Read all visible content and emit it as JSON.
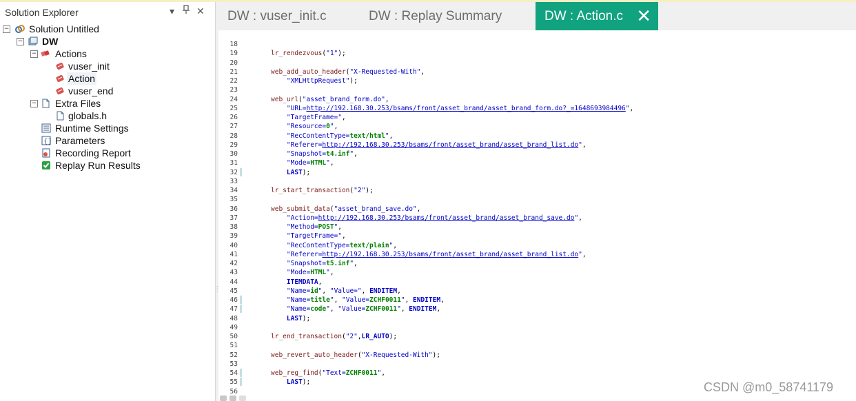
{
  "solution_explorer": {
    "title": "Solution Explorer",
    "controls": {
      "dropdown": "▾",
      "pin": "ꟷ",
      "close": "✕"
    },
    "tree": {
      "solution": "Solution Untitled",
      "project": "DW",
      "actions_folder": "Actions",
      "actions": [
        "vuser_init",
        "Action",
        "vuser_end"
      ],
      "extra_files_folder": "Extra Files",
      "extra_files": [
        "globals.h"
      ],
      "items": [
        "Runtime Settings",
        "Parameters",
        "Recording Report",
        "Replay Run Results"
      ]
    },
    "selected_item": "Action"
  },
  "tabs": [
    {
      "label": "DW : vuser_init.c",
      "active": false
    },
    {
      "label": "DW : Replay Summary",
      "active": false
    },
    {
      "label": "DW : Action.c",
      "active": true
    }
  ],
  "colors": {
    "active_tab": "#11a37f"
  },
  "code": {
    "lines": [
      {
        "n": "18",
        "parts": []
      },
      {
        "n": "19",
        "parts": [
          [
            "fn",
            "lr_rendezvous"
          ],
          [
            "t",
            "("
          ],
          [
            "str",
            "\"1\""
          ],
          [
            "t",
            ");"
          ]
        ]
      },
      {
        "n": "20",
        "parts": []
      },
      {
        "n": "21",
        "parts": [
          [
            "fn",
            "web_add_auto_header"
          ],
          [
            "t",
            "("
          ],
          [
            "str",
            "\"X-Requested-With\""
          ],
          [
            "t",
            ","
          ]
        ]
      },
      {
        "n": "22",
        "parts": [
          [
            "t",
            "    "
          ],
          [
            "str",
            "\"XMLHttpRequest\""
          ],
          [
            "t",
            ");"
          ]
        ]
      },
      {
        "n": "23",
        "parts": []
      },
      {
        "n": "24",
        "parts": [
          [
            "fn",
            "web_url"
          ],
          [
            "t",
            "("
          ],
          [
            "str",
            "\"asset_brand_form.do\""
          ],
          [
            "t",
            ","
          ]
        ]
      },
      {
        "n": "25",
        "parts": [
          [
            "t",
            "    "
          ],
          [
            "str",
            "\"URL="
          ],
          [
            "url",
            "http://192.168.30.253/bsams/front/asset_brand/asset_brand_form.do?_=1648693984496"
          ],
          [
            "str",
            "\""
          ],
          [
            "t",
            ","
          ]
        ]
      },
      {
        "n": "26",
        "parts": [
          [
            "t",
            "    "
          ],
          [
            "str",
            "\"TargetFrame=\""
          ],
          [
            "t",
            ","
          ]
        ]
      },
      {
        "n": "27",
        "parts": [
          [
            "t",
            "    "
          ],
          [
            "str",
            "\"Resource="
          ],
          [
            "gr",
            "0"
          ],
          [
            "str",
            "\""
          ],
          [
            "t",
            ","
          ]
        ]
      },
      {
        "n": "28",
        "parts": [
          [
            "t",
            "    "
          ],
          [
            "str",
            "\"RecContentType="
          ],
          [
            "gr",
            "text/html"
          ],
          [
            "str",
            "\""
          ],
          [
            "t",
            ","
          ]
        ]
      },
      {
        "n": "29",
        "parts": [
          [
            "t",
            "    "
          ],
          [
            "str",
            "\"Referer="
          ],
          [
            "url",
            "http://192.168.30.253/bsams/front/asset_brand/asset_brand_list.do"
          ],
          [
            "str",
            "\""
          ],
          [
            "t",
            ","
          ]
        ]
      },
      {
        "n": "30",
        "parts": [
          [
            "t",
            "    "
          ],
          [
            "str",
            "\"Snapshot="
          ],
          [
            "gr",
            "t4.inf"
          ],
          [
            "str",
            "\""
          ],
          [
            "t",
            ","
          ]
        ]
      },
      {
        "n": "31",
        "parts": [
          [
            "t",
            "    "
          ],
          [
            "str",
            "\"Mode="
          ],
          [
            "gr",
            "HTML"
          ],
          [
            "str",
            "\""
          ],
          [
            "t",
            ","
          ]
        ]
      },
      {
        "n": "32",
        "parts": [
          [
            "t",
            "    "
          ],
          [
            "kw",
            "LAST"
          ],
          [
            "t",
            ");"
          ]
        ],
        "mark": true
      },
      {
        "n": "33",
        "parts": []
      },
      {
        "n": "34",
        "parts": [
          [
            "fn",
            "lr_start_transaction"
          ],
          [
            "t",
            "("
          ],
          [
            "str",
            "\"2\""
          ],
          [
            "t",
            ");"
          ]
        ]
      },
      {
        "n": "35",
        "parts": []
      },
      {
        "n": "36",
        "parts": [
          [
            "fn",
            "web_submit_data"
          ],
          [
            "t",
            "("
          ],
          [
            "str",
            "\"asset_brand_save.do\""
          ],
          [
            "t",
            ","
          ]
        ]
      },
      {
        "n": "37",
        "parts": [
          [
            "t",
            "    "
          ],
          [
            "str",
            "\"Action="
          ],
          [
            "url",
            "http://192.168.30.253/bsams/front/asset_brand/asset_brand_save.do"
          ],
          [
            "str",
            "\""
          ],
          [
            "t",
            ","
          ]
        ]
      },
      {
        "n": "38",
        "parts": [
          [
            "t",
            "    "
          ],
          [
            "str",
            "\"Method="
          ],
          [
            "gr",
            "POST"
          ],
          [
            "str",
            "\""
          ],
          [
            "t",
            ","
          ]
        ]
      },
      {
        "n": "39",
        "parts": [
          [
            "t",
            "    "
          ],
          [
            "str",
            "\"TargetFrame=\""
          ],
          [
            "t",
            ","
          ]
        ]
      },
      {
        "n": "40",
        "parts": [
          [
            "t",
            "    "
          ],
          [
            "str",
            "\"RecContentType="
          ],
          [
            "gr",
            "text/plain"
          ],
          [
            "str",
            "\""
          ],
          [
            "t",
            ","
          ]
        ]
      },
      {
        "n": "41",
        "parts": [
          [
            "t",
            "    "
          ],
          [
            "str",
            "\"Referer="
          ],
          [
            "url",
            "http://192.168.30.253/bsams/front/asset_brand/asset_brand_list.do"
          ],
          [
            "str",
            "\""
          ],
          [
            "t",
            ","
          ]
        ]
      },
      {
        "n": "42",
        "parts": [
          [
            "t",
            "    "
          ],
          [
            "str",
            "\"Snapshot="
          ],
          [
            "gr",
            "t5.inf"
          ],
          [
            "str",
            "\""
          ],
          [
            "t",
            ","
          ]
        ]
      },
      {
        "n": "43",
        "parts": [
          [
            "t",
            "    "
          ],
          [
            "str",
            "\"Mode="
          ],
          [
            "gr",
            "HTML"
          ],
          [
            "str",
            "\""
          ],
          [
            "t",
            ","
          ]
        ]
      },
      {
        "n": "44",
        "parts": [
          [
            "t",
            "    "
          ],
          [
            "kw",
            "ITEMDATA"
          ],
          [
            "t",
            ","
          ]
        ]
      },
      {
        "n": "45",
        "parts": [
          [
            "t",
            "    "
          ],
          [
            "str",
            "\"Name="
          ],
          [
            "gr",
            "id"
          ],
          [
            "str",
            "\""
          ],
          [
            "t",
            ", "
          ],
          [
            "str",
            "\"Value=\""
          ],
          [
            "t",
            ", "
          ],
          [
            "kw",
            "ENDITEM"
          ],
          [
            "t",
            ","
          ]
        ]
      },
      {
        "n": "46",
        "parts": [
          [
            "t",
            "    "
          ],
          [
            "str",
            "\"Name="
          ],
          [
            "gr",
            "title"
          ],
          [
            "str",
            "\""
          ],
          [
            "t",
            ", "
          ],
          [
            "str",
            "\"Value="
          ],
          [
            "gr",
            "ZCHF0011"
          ],
          [
            "str",
            "\""
          ],
          [
            "t",
            ", "
          ],
          [
            "kw",
            "ENDITEM"
          ],
          [
            "t",
            ","
          ]
        ],
        "mark": true
      },
      {
        "n": "47",
        "parts": [
          [
            "t",
            "    "
          ],
          [
            "str",
            "\"Name="
          ],
          [
            "gr",
            "code"
          ],
          [
            "str",
            "\""
          ],
          [
            "t",
            ", "
          ],
          [
            "str",
            "\"Value="
          ],
          [
            "gr",
            "ZCHF0011"
          ],
          [
            "str",
            "\""
          ],
          [
            "t",
            ", "
          ],
          [
            "kw",
            "ENDITEM"
          ],
          [
            "t",
            ","
          ]
        ],
        "mark": true
      },
      {
        "n": "48",
        "parts": [
          [
            "t",
            "    "
          ],
          [
            "kw",
            "LAST"
          ],
          [
            "t",
            ");"
          ]
        ]
      },
      {
        "n": "49",
        "parts": []
      },
      {
        "n": "50",
        "parts": [
          [
            "fn",
            "lr_end_transaction"
          ],
          [
            "t",
            "("
          ],
          [
            "str",
            "\"2\""
          ],
          [
            "t",
            ","
          ],
          [
            "kw",
            "LR_AUTO"
          ],
          [
            "t",
            ");"
          ]
        ]
      },
      {
        "n": "51",
        "parts": []
      },
      {
        "n": "52",
        "parts": [
          [
            "fn",
            "web_revert_auto_header"
          ],
          [
            "t",
            "("
          ],
          [
            "str",
            "\"X-Requested-With\""
          ],
          [
            "t",
            ");"
          ]
        ]
      },
      {
        "n": "53",
        "parts": []
      },
      {
        "n": "54",
        "parts": [
          [
            "fn",
            "web_reg_find"
          ],
          [
            "t",
            "("
          ],
          [
            "str",
            "\"Text="
          ],
          [
            "gr",
            "ZCHF0011"
          ],
          [
            "str",
            "\""
          ],
          [
            "t",
            ","
          ]
        ],
        "mark": true
      },
      {
        "n": "55",
        "parts": [
          [
            "t",
            "    "
          ],
          [
            "kw",
            "LAST"
          ],
          [
            "t",
            ");"
          ]
        ],
        "mark": true
      },
      {
        "n": "56",
        "parts": []
      }
    ]
  },
  "watermark": "CSDN @m0_58741179"
}
